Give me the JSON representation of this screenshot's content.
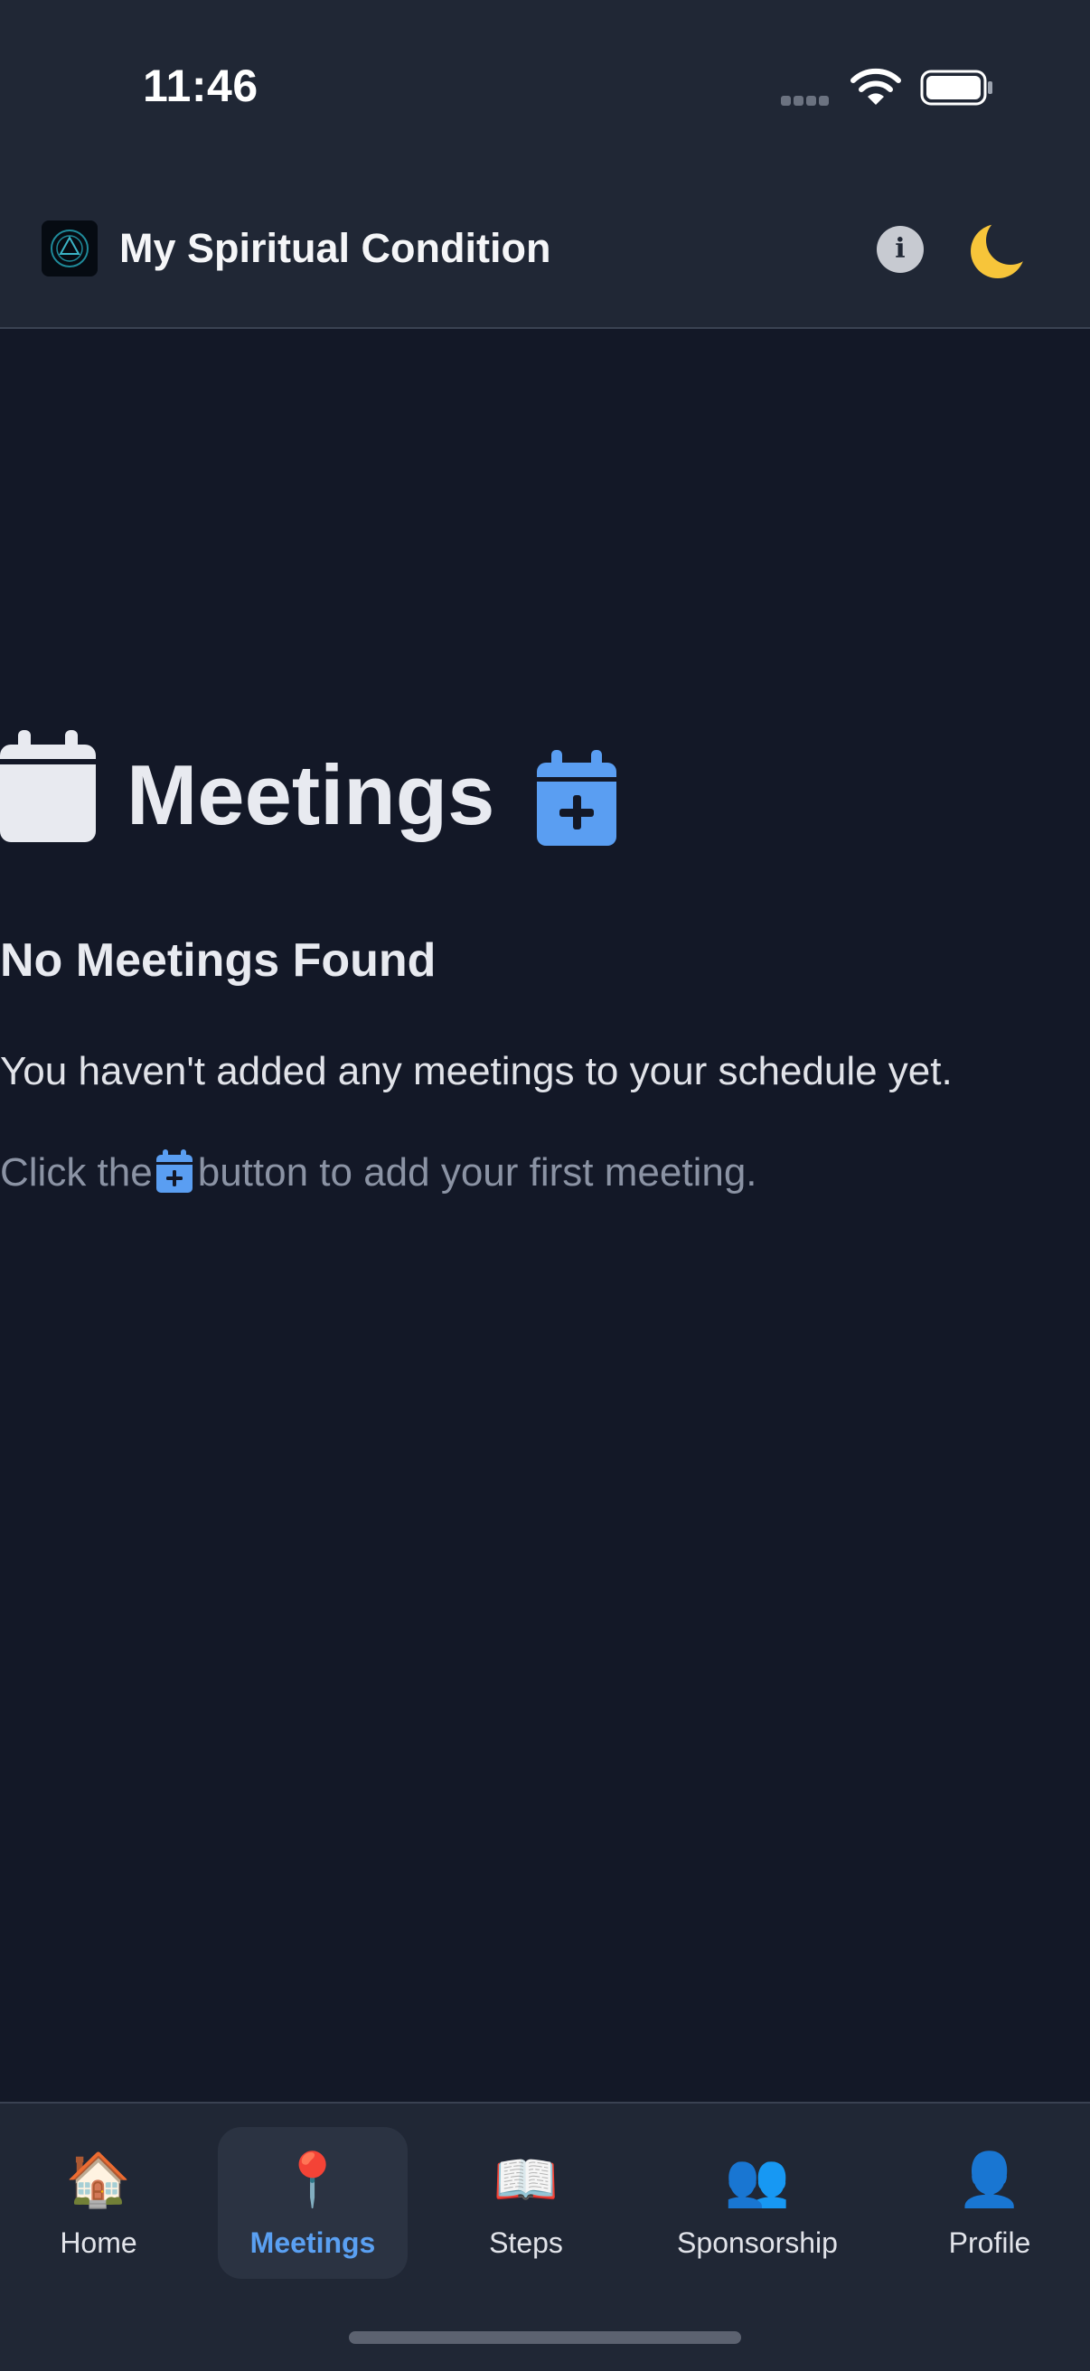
{
  "status_bar": {
    "time": "11:46",
    "icons": [
      "cellular-signal-icon",
      "wifi-icon",
      "battery-icon"
    ]
  },
  "header": {
    "app_title": "My Spiritual Condition",
    "logo_icon": "app-logo-icon",
    "info_icon": "info-icon",
    "theme_icon": "crescent-moon-icon",
    "theme_emoji": "🌙"
  },
  "main": {
    "heading_icon": "calendar-icon",
    "title": "Meetings",
    "add_button_icon": "calendar-plus-icon",
    "empty_state": {
      "title": "No Meetings Found",
      "message": "You haven't added any meetings to your schedule yet.",
      "hint_before": "Click the",
      "hint_after": "button to add your first meeting."
    }
  },
  "tab_bar": {
    "active": "Meetings",
    "tabs": [
      {
        "label": "Home",
        "emoji": "🏠",
        "icon": "house-icon"
      },
      {
        "label": "Meetings",
        "emoji": "📍",
        "icon": "round-pushpin-icon"
      },
      {
        "label": "Steps",
        "emoji": "📖",
        "icon": "open-book-icon"
      },
      {
        "label": "Sponsorship",
        "emoji": "👥",
        "icon": "people-icon"
      },
      {
        "label": "Profile",
        "emoji": "👤",
        "icon": "person-icon"
      }
    ]
  },
  "colors": {
    "background": "#131827",
    "surface": "#202735",
    "accent": "#5aa0f2",
    "text_primary": "#e8eaf0",
    "text_muted": "#8b93a4"
  }
}
